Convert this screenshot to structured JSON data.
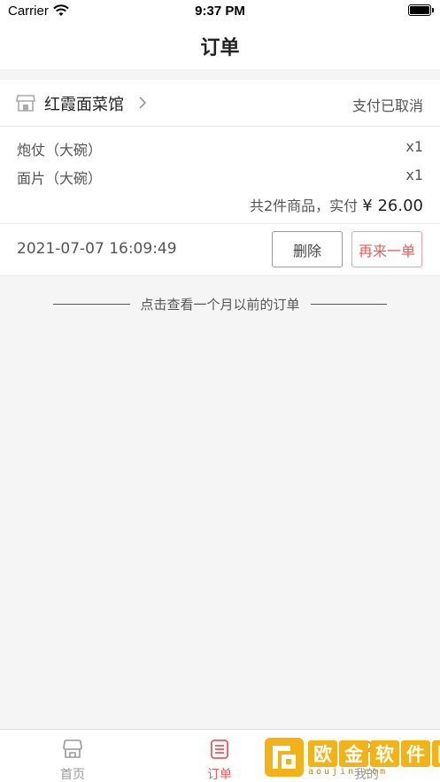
{
  "status_bar": {
    "carrier": "Carrier",
    "time": "9:37 PM"
  },
  "header": {
    "title": "订单"
  },
  "order": {
    "shop_name": "红霞面菜馆",
    "status": "支付已取消",
    "items": [
      {
        "name": "炮仗（大碗）",
        "qty": "x1"
      },
      {
        "name": "面片（大碗）",
        "qty": "x1"
      }
    ],
    "summary_prefix": "共2件商品，实付",
    "price": "¥ 26.00",
    "time": "2021-07-07 16:09:49",
    "delete_label": "删除",
    "reorder_label": "再来一单"
  },
  "history_link": "点击查看一个月以前的订单",
  "tabbar": {
    "tabs": [
      {
        "label": "首页",
        "icon": "shop-icon",
        "active": false
      },
      {
        "label": "订单",
        "icon": "order-list-icon",
        "active": true
      },
      {
        "label": "我的",
        "icon": "user-icon",
        "active": false
      }
    ]
  },
  "watermark": {
    "chars": [
      "欧",
      "金",
      "软",
      "件",
      "园"
    ],
    "url": "aoujin.com"
  },
  "colors": {
    "accent": "#ec5a5a",
    "background": "#f5f5f5",
    "watermark": "#f3b316"
  }
}
